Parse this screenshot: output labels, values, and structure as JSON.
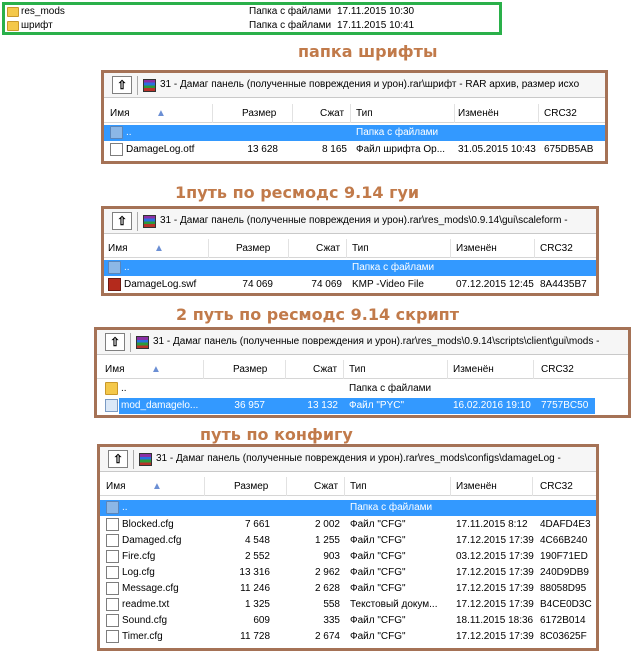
{
  "top_list": [
    {
      "name": "res_mods",
      "type": "Папка с файлами",
      "date": "17.11.2015 10:30"
    },
    {
      "name": "шрифт",
      "type": "Папка с файлами",
      "date": "17.11.2015 10:41"
    }
  ],
  "captions": {
    "c1": "папка шрифты",
    "c2": "1путь по ресмодс 9.14   гуи",
    "c3": "2 путь по ресмодс 9.14   скрипт",
    "c4": "путь по конфигу"
  },
  "columns": {
    "name": "Имя",
    "size": "Размер",
    "packed": "Сжат",
    "type": "Тип",
    "modified": "Изменён",
    "crc": "CRC32"
  },
  "panel1": {
    "path": "31 - Дамаг панель (полученные повреждения и урон).rar\\шрифт - RAR архив, размер исхо",
    "rows": [
      {
        "name": "..",
        "size": "",
        "packed": "",
        "type": "Папка с файлами",
        "modified": "",
        "crc": "",
        "icon": "folder-up-icon"
      },
      {
        "name": "DamageLog.otf",
        "size": "13 628",
        "packed": "8 165",
        "type": "Файл шрифта Op...",
        "modified": "31.05.2015 10:43",
        "crc": "675DB5AB",
        "icon": "file-icon"
      }
    ]
  },
  "panel2": {
    "path": "31 - Дамаг панель (полученные повреждения и урон).rar\\res_mods\\0.9.14\\gui\\scaleform -",
    "rows": [
      {
        "name": "..",
        "size": "",
        "packed": "",
        "type": "Папка с файлами",
        "modified": "",
        "crc": "",
        "icon": "folder-up-icon"
      },
      {
        "name": "DamageLog.swf",
        "size": "74 069",
        "packed": "74 069",
        "type": "KMP -Video File",
        "modified": "07.12.2015 12:45",
        "crc": "8A4435B7",
        "icon": "swf-icon"
      }
    ]
  },
  "panel3": {
    "path": "31 - Дамаг панель (полученные повреждения и урон).rar\\res_mods\\0.9.14\\scripts\\client\\gui\\mods -",
    "rows": [
      {
        "name": "..",
        "size": "",
        "packed": "",
        "type": "Папка с файлами",
        "modified": "",
        "crc": "",
        "icon": "folder-up-icon"
      },
      {
        "name": "mod_damagelo...",
        "size": "36 957",
        "packed": "13 132",
        "type": "Файл \"PYC\"",
        "modified": "16.02.2016 19:10",
        "crc": "7757BC50",
        "icon": "pyc-icon"
      }
    ]
  },
  "panel4": {
    "path": "31 - Дамаг панель (полученные повреждения и урон).rar\\res_mods\\configs\\damageLog -",
    "rows": [
      {
        "name": "..",
        "size": "",
        "packed": "",
        "type": "Папка с файлами",
        "modified": "",
        "crc": "",
        "icon": "folder-up-icon"
      },
      {
        "name": "Blocked.cfg",
        "size": "7 661",
        "packed": "2 002",
        "type": "Файл \"CFG\"",
        "modified": "17.11.2015 8:12",
        "crc": "4DAFD4E3",
        "icon": "file-icon"
      },
      {
        "name": "Damaged.cfg",
        "size": "4 548",
        "packed": "1 255",
        "type": "Файл \"CFG\"",
        "modified": "17.12.2015 17:39",
        "crc": "4C66B240",
        "icon": "file-icon"
      },
      {
        "name": "Fire.cfg",
        "size": "2 552",
        "packed": "903",
        "type": "Файл \"CFG\"",
        "modified": "03.12.2015 17:39",
        "crc": "190F71ED",
        "icon": "file-icon"
      },
      {
        "name": "Log.cfg",
        "size": "13 316",
        "packed": "2 962",
        "type": "Файл \"CFG\"",
        "modified": "17.12.2015 17:39",
        "crc": "240D9DB9",
        "icon": "file-icon"
      },
      {
        "name": "Message.cfg",
        "size": "11 246",
        "packed": "2 628",
        "type": "Файл \"CFG\"",
        "modified": "17.12.2015 17:39",
        "crc": "88058D95",
        "icon": "file-icon"
      },
      {
        "name": "readme.txt",
        "size": "1 325",
        "packed": "558",
        "type": "Текстовый докум...",
        "modified": "17.12.2015 17:39",
        "crc": "B4CE0D3C",
        "icon": "file-icon"
      },
      {
        "name": "Sound.cfg",
        "size": "609",
        "packed": "335",
        "type": "Файл \"CFG\"",
        "modified": "18.11.2015 18:36",
        "crc": "6172B014",
        "icon": "file-icon"
      },
      {
        "name": "Timer.cfg",
        "size": "11 728",
        "packed": "2 674",
        "type": "Файл \"CFG\"",
        "modified": "17.12.2015 17:39",
        "crc": "8C03625F",
        "icon": "file-icon"
      }
    ]
  }
}
